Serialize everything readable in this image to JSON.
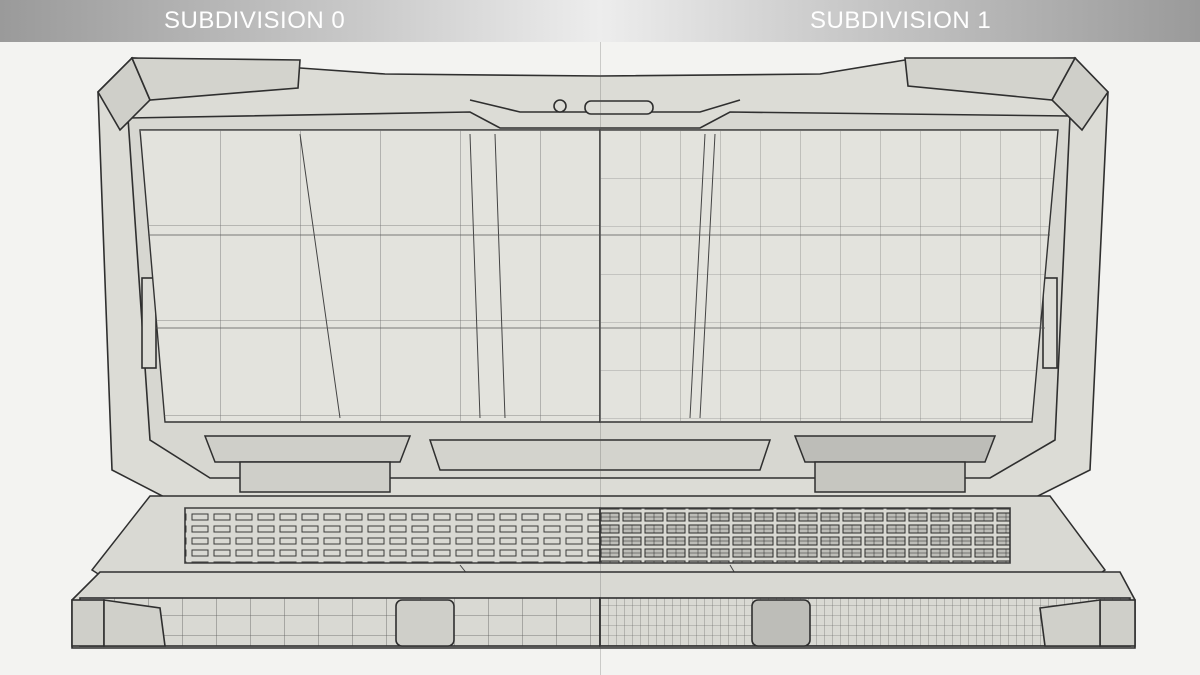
{
  "header": {
    "left_label": "SUBDIVISION 0",
    "right_label": "SUBDIVISION 1",
    "gradient_colors": [
      "#9a9a9a",
      "#ededed"
    ]
  },
  "render": {
    "subject": "rugged-laptop-wireframe",
    "line_color": "#3a3a3a",
    "surface_color": "#dcdcd6"
  }
}
